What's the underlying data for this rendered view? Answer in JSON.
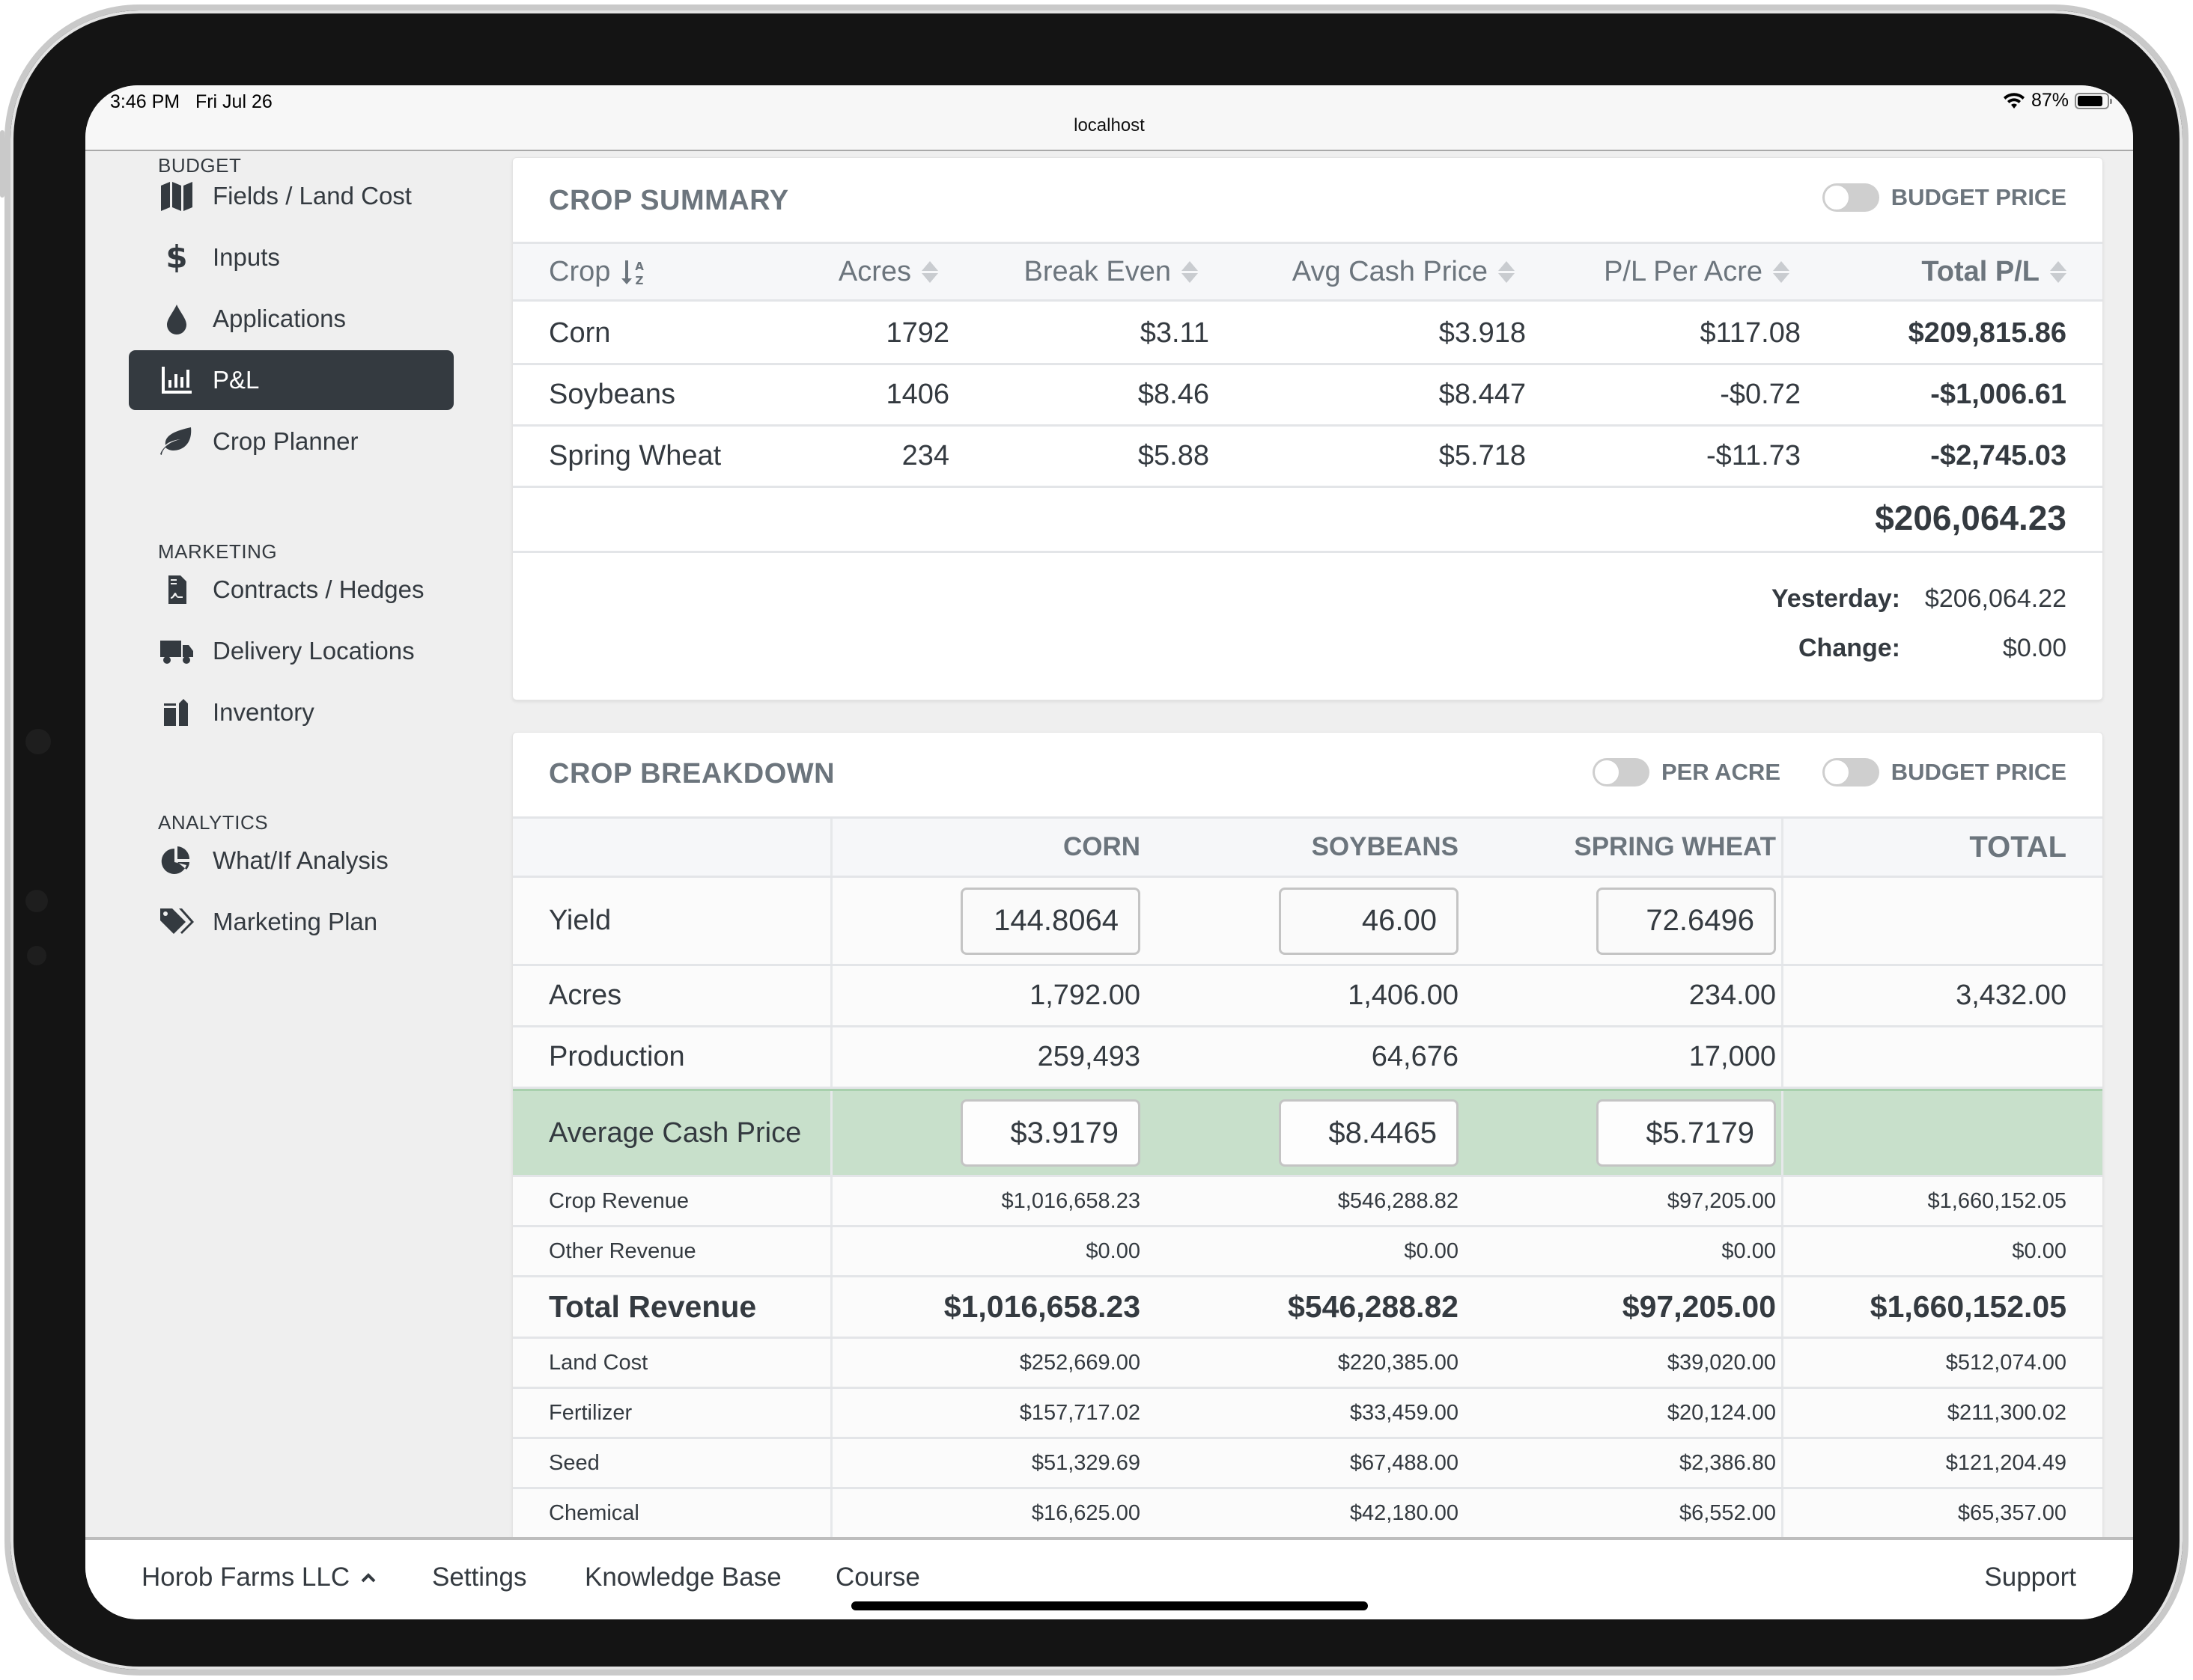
{
  "status_bar": {
    "time": "3:46 PM",
    "date": "Fri Jul 26",
    "url": "localhost",
    "battery_percent": "87%",
    "battery_level": 0.87
  },
  "sidebar": {
    "sections": [
      {
        "heading": "BUDGET",
        "items": [
          {
            "label": "Fields / Land Cost",
            "icon": "map-icon",
            "active": false
          },
          {
            "label": "Inputs",
            "icon": "dollar-icon",
            "active": false
          },
          {
            "label": "Applications",
            "icon": "droplet-icon",
            "active": false
          },
          {
            "label": "P&L",
            "icon": "bar-chart-icon",
            "active": true
          },
          {
            "label": "Crop Planner",
            "icon": "leaf-icon",
            "active": false
          }
        ]
      },
      {
        "heading": "MARKETING",
        "items": [
          {
            "label": "Contracts / Hedges",
            "icon": "contract-icon",
            "active": false
          },
          {
            "label": "Delivery Locations",
            "icon": "truck-icon",
            "active": false
          },
          {
            "label": "Inventory",
            "icon": "silo-icon",
            "active": false
          }
        ]
      },
      {
        "heading": "ANALYTICS",
        "items": [
          {
            "label": "What/If Analysis",
            "icon": "pie-chart-icon",
            "active": false
          },
          {
            "label": "Marketing Plan",
            "icon": "tags-icon",
            "active": false
          }
        ]
      }
    ]
  },
  "crop_summary": {
    "title": "CROP SUMMARY",
    "toggle_budget_price": {
      "label": "BUDGET PRICE",
      "on": false
    },
    "columns": [
      "Crop",
      "Acres",
      "Break Even",
      "Avg Cash Price",
      "P/L Per Acre",
      "Total P/L"
    ],
    "rows": [
      {
        "crop": "Corn",
        "acres": "1792",
        "break_even": "$3.11",
        "avg_cash_price": "$3.918",
        "pl_per_acre": "$117.08",
        "total_pl": "$209,815.86"
      },
      {
        "crop": "Soybeans",
        "acres": "1406",
        "break_even": "$8.46",
        "avg_cash_price": "$8.447",
        "pl_per_acre": "-$0.72",
        "total_pl": "-$1,006.61"
      },
      {
        "crop": "Spring Wheat",
        "acres": "234",
        "break_even": "$5.88",
        "avg_cash_price": "$5.718",
        "pl_per_acre": "-$11.73",
        "total_pl": "-$2,745.03"
      }
    ],
    "grand_total": "$206,064.23",
    "yesterday_label": "Yesterday:",
    "yesterday_value": "$206,064.22",
    "change_label": "Change:",
    "change_value": "$0.00"
  },
  "crop_breakdown": {
    "title": "CROP BREAKDOWN",
    "toggle_per_acre": {
      "label": "PER ACRE",
      "on": false
    },
    "toggle_budget_price": {
      "label": "BUDGET PRICE",
      "on": false
    },
    "columns": [
      "CORN",
      "SOYBEANS",
      "SPRING WHEAT",
      "TOTAL"
    ],
    "rows": [
      {
        "label": "Yield",
        "type": "input",
        "values": [
          "144.8064",
          "46.00",
          "72.6496",
          ""
        ]
      },
      {
        "label": "Acres",
        "type": "text",
        "values": [
          "1,792.00",
          "1,406.00",
          "234.00",
          "3,432.00"
        ]
      },
      {
        "label": "Production",
        "type": "text",
        "values": [
          "259,493",
          "64,676",
          "17,000",
          ""
        ]
      },
      {
        "label": "Average Cash Price",
        "type": "input-green",
        "values": [
          "$3.9179",
          "$8.4465",
          "$5.7179",
          ""
        ]
      },
      {
        "label": "Crop Revenue",
        "type": "small",
        "values": [
          "$1,016,658.23",
          "$546,288.82",
          "$97,205.00",
          "$1,660,152.05"
        ]
      },
      {
        "label": "Other Revenue",
        "type": "small",
        "values": [
          "$0.00",
          "$0.00",
          "$0.00",
          "$0.00"
        ]
      },
      {
        "label": "Total Revenue",
        "type": "bold",
        "values": [
          "$1,016,658.23",
          "$546,288.82",
          "$97,205.00",
          "$1,660,152.05"
        ]
      },
      {
        "label": "Land Cost",
        "type": "small",
        "values": [
          "$252,669.00",
          "$220,385.00",
          "$39,020.00",
          "$512,074.00"
        ]
      },
      {
        "label": "Fertilizer",
        "type": "small",
        "values": [
          "$157,717.02",
          "$33,459.00",
          "$20,124.00",
          "$211,300.02"
        ]
      },
      {
        "label": "Seed",
        "type": "small",
        "values": [
          "$51,329.69",
          "$67,488.00",
          "$2,386.80",
          "$121,204.49"
        ]
      },
      {
        "label": "Chemical",
        "type": "small",
        "values": [
          "$16,625.00",
          "$42,180.00",
          "$6,552.00",
          "$65,357.00"
        ]
      }
    ]
  },
  "bottom_bar": {
    "company": "Horob Farms LLC",
    "items": [
      "Settings",
      "Knowledge Base",
      "Course"
    ],
    "support": "Support"
  },
  "colors": {
    "accent_dark": "#343a40",
    "muted": "#6c757d",
    "highlight_green": "#c8e0cb"
  }
}
